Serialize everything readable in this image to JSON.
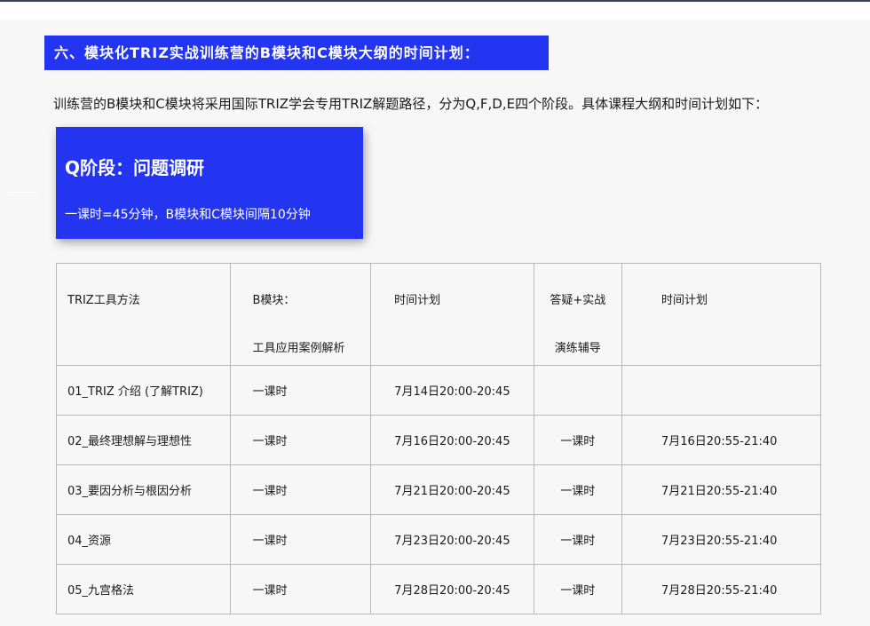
{
  "section": {
    "heading": "六、模块化TRIZ实战训练营的B模块和C模块大纲的时间计划："
  },
  "intro": {
    "text": "训练营的B模块和C模块将采用国际TRIZ学会专用TRIZ解题路径，分为Q,F,D,E四个阶段。具体课程大纲和时间计划如下："
  },
  "phase_card": {
    "title": "Q阶段：问题调研",
    "subtitle": "一课时=45分钟，B模块和C模块间隔10分钟"
  },
  "table": {
    "headers": [
      {
        "line1": "TRIZ工具方法",
        "line2": ""
      },
      {
        "line1": "B模块：",
        "line2": "工具应用案例解析"
      },
      {
        "line1": "时间计划",
        "line2": ""
      },
      {
        "line1": "答疑+实战",
        "line2": "演练辅导"
      },
      {
        "line1": "时间计划",
        "line2": ""
      }
    ],
    "rows": [
      {
        "tool": "01_TRIZ 介绍 (了解TRIZ)",
        "b_module": "一课时",
        "b_time": "7月14日20:00-20:45",
        "practice": "",
        "practice_time": ""
      },
      {
        "tool": "02_最终理想解与理想性",
        "b_module": "一课时",
        "b_time": "7月16日20:00-20:45",
        "practice": "一课时",
        "practice_time": "7月16日20:55-21:40"
      },
      {
        "tool": "03_要因分析与根因分析",
        "b_module": "一课时",
        "b_time": "7月21日20:00-20:45",
        "practice": "一课时",
        "practice_time": "7月21日20:55-21:40"
      },
      {
        "tool": "04_资源",
        "b_module": "一课时",
        "b_time": "7月23日20:00-20:45",
        "practice": "一课时",
        "practice_time": "7月23日20:55-21:40"
      },
      {
        "tool": "05_九宫格法",
        "b_module": "一课时",
        "b_time": "7月28日20:00-20:45",
        "practice": "一课时",
        "practice_time": "7月28日20:55-21:40"
      }
    ]
  },
  "colors": {
    "accent_blue": "#2335f0",
    "page_background": "#f7f7f7",
    "table_border": "#b8b8b8"
  }
}
